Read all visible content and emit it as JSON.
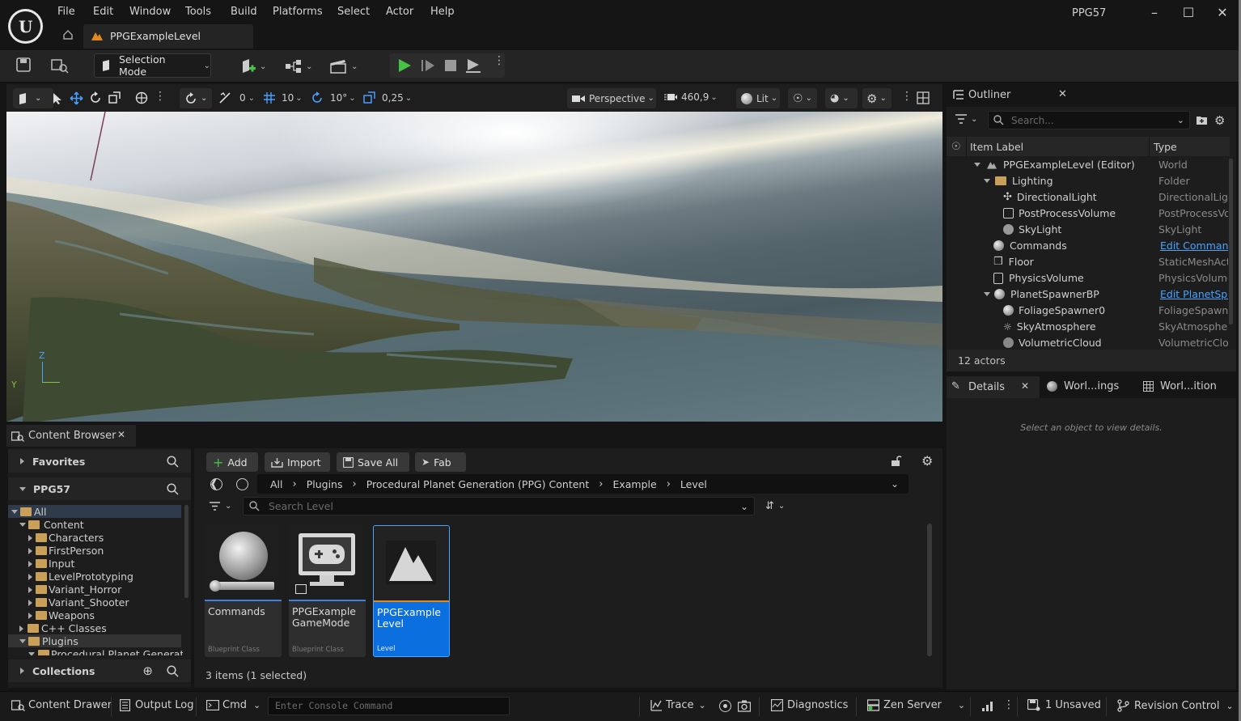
{
  "app": {
    "project_name": "PPG57",
    "menu": [
      "File",
      "Edit",
      "Window",
      "Tools",
      "Build",
      "Platforms",
      "Select",
      "Actor",
      "Help"
    ],
    "level_tab": "PPGExampleLevel"
  },
  "toolbar": {
    "mode_label": "Selection Mode"
  },
  "viewport_toolbar": {
    "rotation_snap_count": "0",
    "grid_snap": "10",
    "rotate_snap": "10°",
    "scale_snap": "0,25",
    "view_mode": "Perspective",
    "camera_speed": "460,9",
    "lighting": "Lit",
    "axis_z": "Z",
    "axis_y": "Y"
  },
  "outliner": {
    "title": "Outliner",
    "search_placeholder": "Search...",
    "col_label": "Item Label",
    "col_type": "Type",
    "rows": [
      {
        "label": "PPGExampleLevel (Editor)",
        "type": "World",
        "link": false
      },
      {
        "label": "Lighting",
        "type": "Folder",
        "link": false
      },
      {
        "label": "DirectionalLight",
        "type": "DirectionalLight",
        "link": false
      },
      {
        "label": "PostProcessVolume",
        "type": "PostProcessVolume",
        "link": false
      },
      {
        "label": "SkyLight",
        "type": "SkyLight",
        "link": false
      },
      {
        "label": "Commands",
        "type": "Edit Commands",
        "link": true
      },
      {
        "label": "Floor",
        "type": "StaticMeshActor",
        "link": false
      },
      {
        "label": "PhysicsVolume",
        "type": "PhysicsVolume",
        "link": false
      },
      {
        "label": "PlanetSpawnerBP",
        "type": "Edit PlanetSpawnerBP",
        "link": true
      },
      {
        "label": "FoliageSpawner0",
        "type": "FoliageSpawner",
        "link": false
      },
      {
        "label": "SkyAtmosphere",
        "type": "SkyAtmosphere",
        "link": false
      },
      {
        "label": "VolumetricCloud",
        "type": "VolumetricCloud",
        "link": false
      }
    ],
    "actor_count": "12 actors"
  },
  "details": {
    "tab_details": "Details",
    "tab_world_settings": "Worl...ings",
    "tab_world_partition": "Worl...ition",
    "empty_msg": "Select an object to view details."
  },
  "content_browser": {
    "title": "Content Browser",
    "favorites": "Favorites",
    "project": "PPG57",
    "collections": "Collections",
    "tree": [
      "All",
      "Content",
      "Characters",
      "FirstPerson",
      "Input",
      "LevelPrototyping",
      "Variant_Horror",
      "Variant_Shooter",
      "Weapons",
      "C++ Classes",
      "Plugins",
      "Procedural Planet Generatio"
    ],
    "btn_add": "Add",
    "btn_import": "Import",
    "btn_save_all": "Save All",
    "btn_fab": "Fab",
    "breadcrumb": [
      "All",
      "Plugins",
      "Procedural Planet Generation (PPG) Content",
      "Example",
      "Level"
    ],
    "search_placeholder": "Search Level",
    "assets": [
      {
        "name": "Commands",
        "class": "Blueprint Class"
      },
      {
        "name": "PPGExample\nGameMode",
        "class": "Blueprint Class"
      },
      {
        "name": "PPGExample\nLevel",
        "class": "Level"
      }
    ],
    "item_count": "3 items (1 selected)"
  },
  "statusbar": {
    "content_drawer": "Content Drawer",
    "output_log": "Output Log",
    "cmd": "Cmd",
    "console_placeholder": "Enter Console Command",
    "trace": "Trace",
    "diagnostics": "Diagnostics",
    "zen_server": "Zen Server",
    "unsaved": "1 Unsaved",
    "revision_control": "Revision Control"
  },
  "colors": {
    "accent_blue": "#0070e0",
    "play_green": "#46c346",
    "folder": "#c8a05a",
    "link": "#4aa3ff"
  }
}
